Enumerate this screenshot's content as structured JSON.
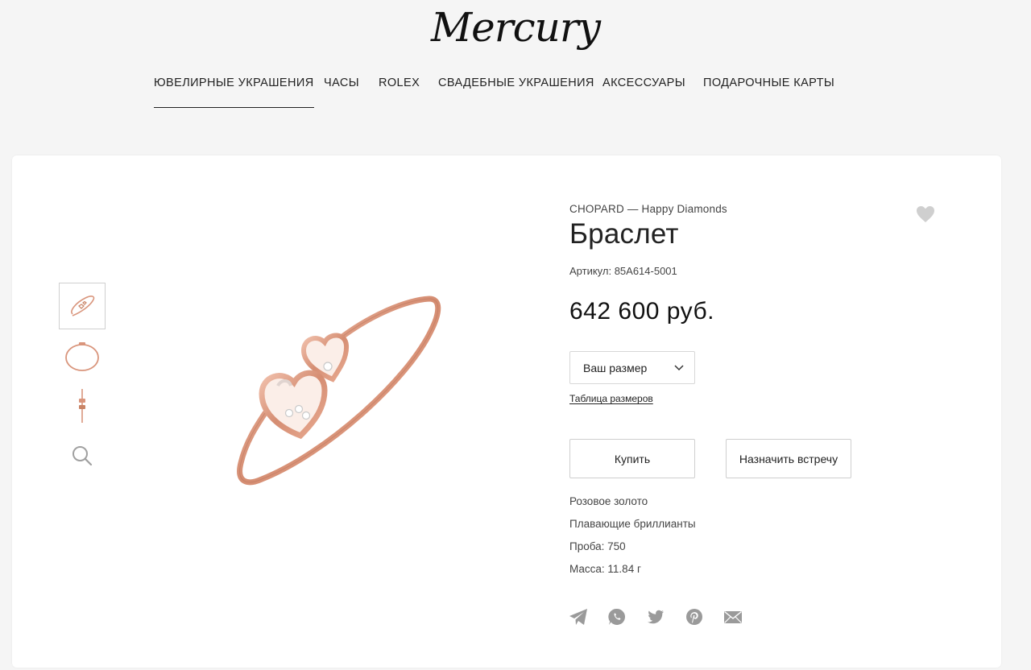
{
  "header": {
    "logo": "Mercury",
    "nav": [
      {
        "label": "ЮВЕЛИРНЫЕ УКРАШЕНИЯ",
        "active": true
      },
      {
        "label": "ЧАСЫ"
      },
      {
        "label": "ROLEX"
      },
      {
        "label": "СВАДЕБНЫЕ УКРАШЕНИЯ"
      },
      {
        "label": "АКСЕССУАРЫ"
      },
      {
        "label": "ПОДАРОЧНЫЕ КАРТЫ"
      }
    ]
  },
  "gallery": {
    "thumbnails": [
      "bracelet-angle-view",
      "bracelet-top-view",
      "bracelet-side-view"
    ],
    "zoom_icon": "search-icon"
  },
  "product": {
    "brand_line": "CHOPARD — Happy Diamonds",
    "title": "Браслет",
    "sku": "Артикул: 85A614-5001",
    "price": "642 600 руб.",
    "size_select": "Ваш размер",
    "size_table_link": "Таблица размеров",
    "buy_button": "Купить",
    "appointment_button": "Назначить встречу",
    "specs": [
      "Розовое золото",
      "Плавающие бриллианты",
      "Проба: 750",
      "Масса: 11.84 г"
    ],
    "favorite_icon": "heart-icon"
  },
  "share": [
    "telegram-icon",
    "whatsapp-icon",
    "twitter-icon",
    "pinterest-icon",
    "mail-icon"
  ],
  "colors": {
    "background": "#f5f5f5",
    "card": "#ffffff",
    "text": "#222222",
    "icon_grey": "#9a9a9a",
    "rose_gold": "#d9957c"
  }
}
